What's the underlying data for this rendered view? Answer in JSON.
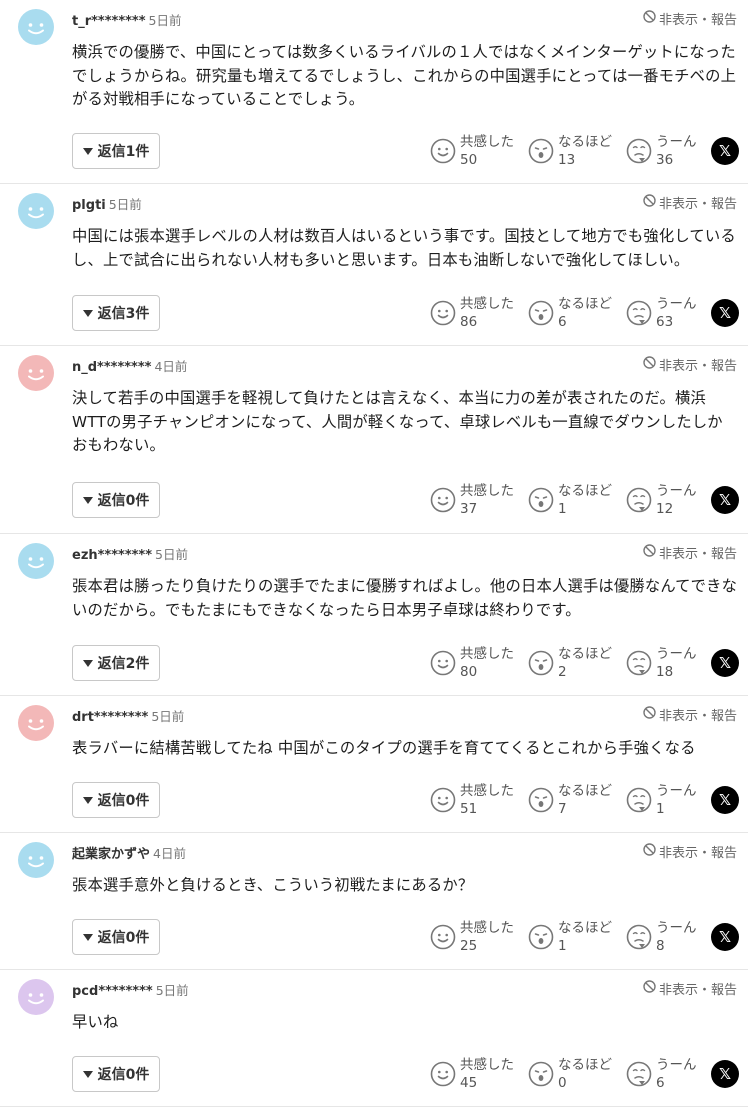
{
  "labels": {
    "report": "非表示・報告",
    "empathy": "共感した",
    "naruhodo": "なるほど",
    "uun": "うーん",
    "x_icon": "x-logo-icon"
  },
  "colors": {
    "avatar_blue": "#a9dcef",
    "avatar_pink": "#f3b8b8",
    "avatar_purple": "#dcc6ee",
    "border": "#e6e6e6"
  },
  "comments": [
    {
      "user": "t_r********",
      "time": "5日前",
      "avatar": "blue",
      "body": "横浜での優勝で、中国にとっては数多くいるライバルの１人ではなくメインターゲットになったでしょうからね。研究量も増えてるでしょうし、これからの中国選手にとっては一番モチベの上がる対戦相手になっていることでしょう。",
      "reply": "返信1件",
      "empathy": "50",
      "naruhodo": "13",
      "uun": "36"
    },
    {
      "user": "plgti",
      "time": "5日前",
      "avatar": "blue",
      "body": "中国には張本選手レベルの人材は数百人はいるという事です。国技として地方でも強化しているし、上で試合に出られない人材も多いと思います。日本も油断しないで強化してほしい。",
      "reply": "返信3件",
      "empathy": "86",
      "naruhodo": "6",
      "uun": "63"
    },
    {
      "user": "n_d********",
      "time": "4日前",
      "avatar": "pink",
      "body": "決して若手の中国選手を軽視して負けたとは言えなく、本当に力の差が表されたのだ。横浜WTTの男子チャンピオンになって、人間が軽くなって、卓球レベルも一直線でダウンしたしかおもわない。",
      "reply": "返信0件",
      "empathy": "37",
      "naruhodo": "1",
      "uun": "12"
    },
    {
      "user": "ezh********",
      "time": "5日前",
      "avatar": "blue",
      "body": "張本君は勝ったり負けたりの選手でたまに優勝すればよし。他の日本人選手は優勝なんてできないのだから。でもたまにもできなくなったら日本男子卓球は終わりです。",
      "reply": "返信2件",
      "empathy": "80",
      "naruhodo": "2",
      "uun": "18"
    },
    {
      "user": "drt********",
      "time": "5日前",
      "avatar": "pink",
      "body": "表ラバーに結構苦戦してたね 中国がこのタイプの選手を育ててくるとこれから手強くなる",
      "reply": "返信0件",
      "empathy": "51",
      "naruhodo": "7",
      "uun": "1"
    },
    {
      "user": "起業家かずや",
      "time": "4日前",
      "avatar": "blue",
      "body": "張本選手意外と負けるとき、こういう初戦たまにあるか？",
      "reply": "返信0件",
      "empathy": "25",
      "naruhodo": "1",
      "uun": "8"
    },
    {
      "user": "pcd********",
      "time": "5日前",
      "avatar": "purple",
      "body": "早いね",
      "reply": "返信0件",
      "empathy": "45",
      "naruhodo": "0",
      "uun": "6"
    }
  ]
}
